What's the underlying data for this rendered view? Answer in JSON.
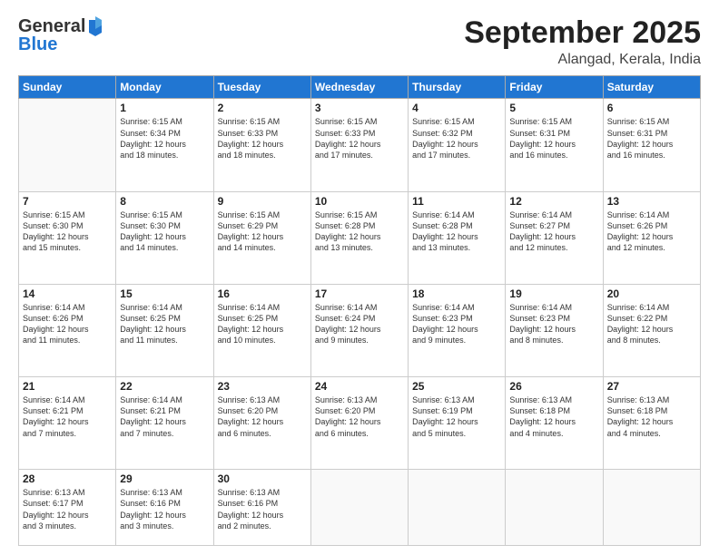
{
  "header": {
    "logo": {
      "general": "General",
      "blue": "Blue"
    },
    "title": "September 2025",
    "subtitle": "Alangad, Kerala, India"
  },
  "weekdays": [
    "Sunday",
    "Monday",
    "Tuesday",
    "Wednesday",
    "Thursday",
    "Friday",
    "Saturday"
  ],
  "weeks": [
    [
      {
        "day": "",
        "empty": true
      },
      {
        "day": "1",
        "sunrise": "6:15 AM",
        "sunset": "6:34 PM",
        "daylight": "12 hours and 18 minutes."
      },
      {
        "day": "2",
        "sunrise": "6:15 AM",
        "sunset": "6:33 PM",
        "daylight": "12 hours and 18 minutes."
      },
      {
        "day": "3",
        "sunrise": "6:15 AM",
        "sunset": "6:33 PM",
        "daylight": "12 hours and 17 minutes."
      },
      {
        "day": "4",
        "sunrise": "6:15 AM",
        "sunset": "6:32 PM",
        "daylight": "12 hours and 17 minutes."
      },
      {
        "day": "5",
        "sunrise": "6:15 AM",
        "sunset": "6:31 PM",
        "daylight": "12 hours and 16 minutes."
      },
      {
        "day": "6",
        "sunrise": "6:15 AM",
        "sunset": "6:31 PM",
        "daylight": "12 hours and 16 minutes."
      }
    ],
    [
      {
        "day": "7",
        "sunrise": "6:15 AM",
        "sunset": "6:30 PM",
        "daylight": "12 hours and 15 minutes."
      },
      {
        "day": "8",
        "sunrise": "6:15 AM",
        "sunset": "6:30 PM",
        "daylight": "12 hours and 14 minutes."
      },
      {
        "day": "9",
        "sunrise": "6:15 AM",
        "sunset": "6:29 PM",
        "daylight": "12 hours and 14 minutes."
      },
      {
        "day": "10",
        "sunrise": "6:15 AM",
        "sunset": "6:28 PM",
        "daylight": "12 hours and 13 minutes."
      },
      {
        "day": "11",
        "sunrise": "6:14 AM",
        "sunset": "6:28 PM",
        "daylight": "12 hours and 13 minutes."
      },
      {
        "day": "12",
        "sunrise": "6:14 AM",
        "sunset": "6:27 PM",
        "daylight": "12 hours and 12 minutes."
      },
      {
        "day": "13",
        "sunrise": "6:14 AM",
        "sunset": "6:26 PM",
        "daylight": "12 hours and 12 minutes."
      }
    ],
    [
      {
        "day": "14",
        "sunrise": "6:14 AM",
        "sunset": "6:26 PM",
        "daylight": "12 hours and 11 minutes."
      },
      {
        "day": "15",
        "sunrise": "6:14 AM",
        "sunset": "6:25 PM",
        "daylight": "12 hours and 11 minutes."
      },
      {
        "day": "16",
        "sunrise": "6:14 AM",
        "sunset": "6:25 PM",
        "daylight": "12 hours and 10 minutes."
      },
      {
        "day": "17",
        "sunrise": "6:14 AM",
        "sunset": "6:24 PM",
        "daylight": "12 hours and 9 minutes."
      },
      {
        "day": "18",
        "sunrise": "6:14 AM",
        "sunset": "6:23 PM",
        "daylight": "12 hours and 9 minutes."
      },
      {
        "day": "19",
        "sunrise": "6:14 AM",
        "sunset": "6:23 PM",
        "daylight": "12 hours and 8 minutes."
      },
      {
        "day": "20",
        "sunrise": "6:14 AM",
        "sunset": "6:22 PM",
        "daylight": "12 hours and 8 minutes."
      }
    ],
    [
      {
        "day": "21",
        "sunrise": "6:14 AM",
        "sunset": "6:21 PM",
        "daylight": "12 hours and 7 minutes."
      },
      {
        "day": "22",
        "sunrise": "6:14 AM",
        "sunset": "6:21 PM",
        "daylight": "12 hours and 7 minutes."
      },
      {
        "day": "23",
        "sunrise": "6:13 AM",
        "sunset": "6:20 PM",
        "daylight": "12 hours and 6 minutes."
      },
      {
        "day": "24",
        "sunrise": "6:13 AM",
        "sunset": "6:20 PM",
        "daylight": "12 hours and 6 minutes."
      },
      {
        "day": "25",
        "sunrise": "6:13 AM",
        "sunset": "6:19 PM",
        "daylight": "12 hours and 5 minutes."
      },
      {
        "day": "26",
        "sunrise": "6:13 AM",
        "sunset": "6:18 PM",
        "daylight": "12 hours and 4 minutes."
      },
      {
        "day": "27",
        "sunrise": "6:13 AM",
        "sunset": "6:18 PM",
        "daylight": "12 hours and 4 minutes."
      }
    ],
    [
      {
        "day": "28",
        "sunrise": "6:13 AM",
        "sunset": "6:17 PM",
        "daylight": "12 hours and 3 minutes."
      },
      {
        "day": "29",
        "sunrise": "6:13 AM",
        "sunset": "6:16 PM",
        "daylight": "12 hours and 3 minutes."
      },
      {
        "day": "30",
        "sunrise": "6:13 AM",
        "sunset": "6:16 PM",
        "daylight": "12 hours and 2 minutes."
      },
      {
        "day": "",
        "empty": true
      },
      {
        "day": "",
        "empty": true
      },
      {
        "day": "",
        "empty": true
      },
      {
        "day": "",
        "empty": true
      }
    ]
  ]
}
